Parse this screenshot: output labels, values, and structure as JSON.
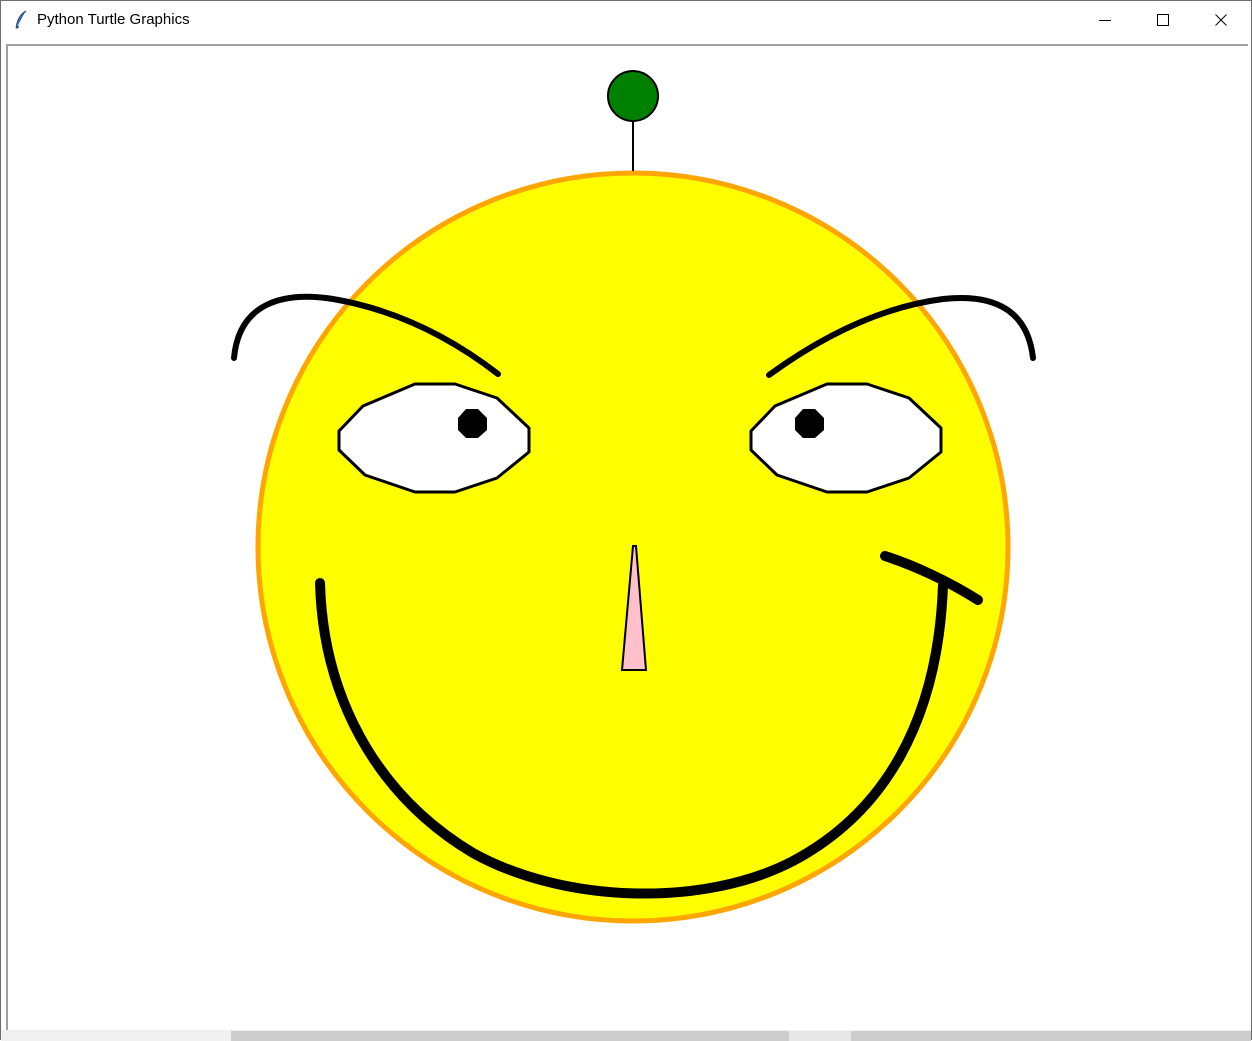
{
  "window": {
    "title": "Python Turtle Graphics",
    "app_icon": "feather-icon",
    "controls": {
      "minimize_icon": "minimize-icon",
      "maximize_icon": "maximize-icon",
      "close_icon": "close-icon"
    }
  },
  "drawing": {
    "face_fill": "#ffff00",
    "face_outline": "#ffa500",
    "antenna_ball_color": "#008000",
    "eye_fill": "#ffffff",
    "pupil_color": "#000000",
    "nose_fill": "#ffc0cb",
    "line_color": "#000000"
  }
}
